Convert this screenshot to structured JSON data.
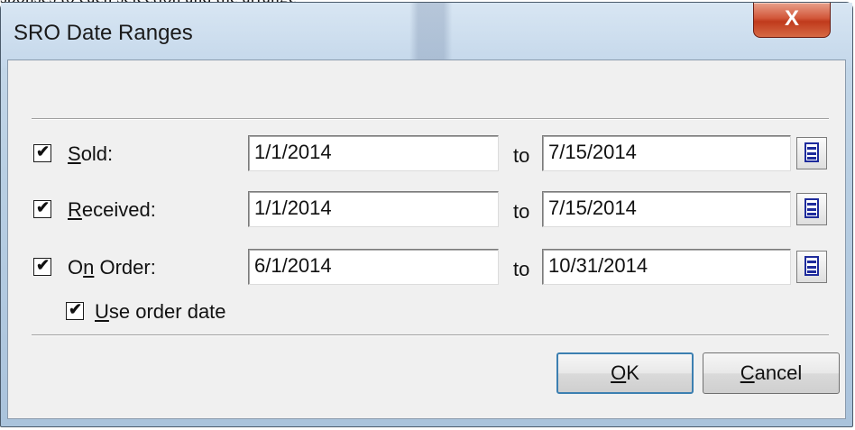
{
  "background_text": "sponses to each selection and the arrange",
  "window": {
    "title": "SRO Date Ranges",
    "close_label": "X"
  },
  "rows": [
    {
      "checked": true,
      "label_prefix": "",
      "label_mnemonic": "S",
      "label_rest": "old:",
      "from": "1/1/2014",
      "to_label": "to",
      "to": "7/15/2014"
    },
    {
      "checked": true,
      "label_prefix": "",
      "label_mnemonic": "R",
      "label_rest": "eceived:",
      "from": "1/1/2014",
      "to_label": "to",
      "to": "7/15/2014"
    },
    {
      "checked": true,
      "label_prefix": "O",
      "label_mnemonic": "n",
      "label_rest": " Order:",
      "from": "6/1/2014",
      "to_label": "to",
      "to": "10/31/2014"
    }
  ],
  "use_order_date": {
    "checked": true,
    "label_mnemonic": "U",
    "label_rest": "se order date"
  },
  "buttons": {
    "ok_mnemonic": "O",
    "ok_rest": "K",
    "cancel_mnemonic": "C",
    "cancel_rest": "ancel"
  },
  "colors": {
    "accent": "#3c7fb1",
    "close": "#c03a1c",
    "calendar_icon": "#1e2b9c"
  }
}
